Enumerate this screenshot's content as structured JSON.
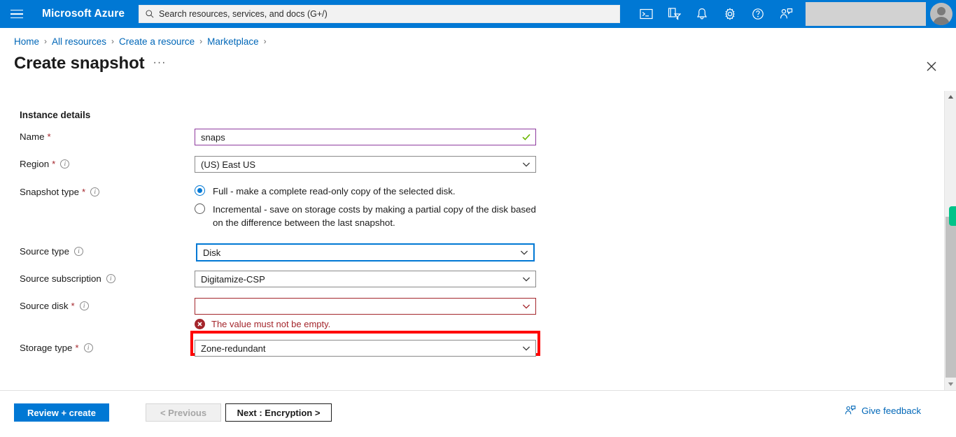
{
  "topbar": {
    "menu_icon": "hamburger-icon",
    "brand": "Microsoft Azure",
    "search": {
      "icon": "search-icon",
      "placeholder": "Search resources, services, and docs (G+/)",
      "value": ""
    },
    "icons": [
      {
        "name": "cloud-shell-icon",
        "title": "Cloud Shell"
      },
      {
        "name": "directory-filter-icon",
        "title": "Directories + subscriptions"
      },
      {
        "name": "notifications-bell-icon",
        "title": "Notifications"
      },
      {
        "name": "settings-gear-icon",
        "title": "Settings"
      },
      {
        "name": "help-question-icon",
        "title": "Help"
      },
      {
        "name": "feedback-person-icon",
        "title": "Feedback"
      }
    ],
    "account_placeholder": "",
    "avatar": "user-avatar"
  },
  "breadcrumb": {
    "items": [
      "Home",
      "All resources",
      "Create a resource",
      "Marketplace"
    ],
    "separator": "›"
  },
  "page": {
    "title": "Create snapshot",
    "more_menu": "···",
    "close": "✕"
  },
  "form": {
    "section_title": "Instance details",
    "name": {
      "label": "Name",
      "required": "*",
      "value": "snaps",
      "validation_icon": "green-check-icon"
    },
    "region": {
      "label": "Region",
      "required": "*",
      "info": "info-icon",
      "value": "(US) East US",
      "chevron": "chevron-down-icon"
    },
    "snapshot_type": {
      "label": "Snapshot type",
      "required": "*",
      "info": "info-icon",
      "options": [
        {
          "label": "Full - make a complete read-only copy of the selected disk.",
          "selected": true
        },
        {
          "label": "Incremental - save on storage costs by making a partial copy of the disk based on the difference between the last snapshot.",
          "selected": false
        }
      ]
    },
    "source_type": {
      "label": "Source type",
      "info": "info-icon",
      "value": "Disk",
      "chevron": "chevron-down-icon",
      "highlighted": true
    },
    "source_subscription": {
      "label": "Source subscription",
      "info": "info-icon",
      "value": "Digitamize-CSP",
      "chevron": "chevron-down-icon"
    },
    "source_disk": {
      "label": "Source disk",
      "required": "*",
      "info": "info-icon",
      "value": "",
      "chevron": "chevron-down-icon",
      "error_icon": "error-circle-icon",
      "error_text": "The value must not be empty."
    },
    "storage_type": {
      "label": "Storage type",
      "required": "*",
      "info": "info-icon",
      "value": "Zone-redundant",
      "chevron": "chevron-down-icon"
    }
  },
  "scrollbar": {
    "up_arrow": "scroll-up-arrow-icon",
    "down_arrow": "scroll-down-arrow-icon",
    "thumb": "scrollbar-thumb"
  },
  "footer": {
    "review_create": "Review + create",
    "previous": "< Previous",
    "next": "Next : Encryption >",
    "feedback_icon": "feedback-person-icon",
    "feedback_label": "Give feedback"
  },
  "colors": {
    "azure_blue": "#0078d4",
    "link_blue": "#0067b8",
    "error_red": "#a4262c",
    "annotation_red": "#ff0000",
    "valid_purple": "#8e3a9e",
    "green_marker": "#00c389"
  }
}
